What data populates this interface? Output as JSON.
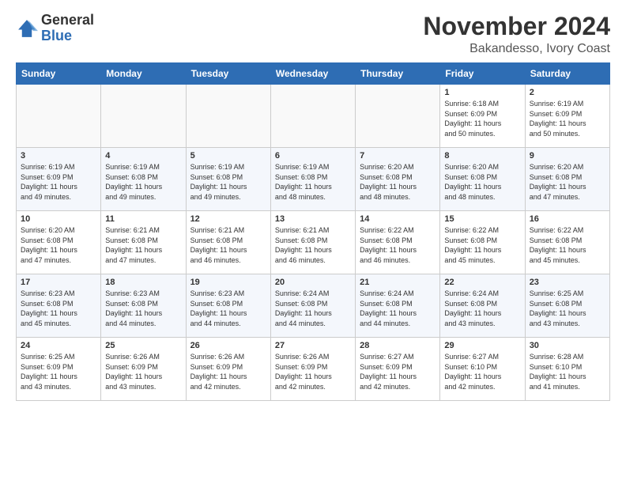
{
  "header": {
    "logo": {
      "general": "General",
      "blue": "Blue"
    },
    "title": "November 2024",
    "location": "Bakandesso, Ivory Coast"
  },
  "calendar": {
    "days_of_week": [
      "Sunday",
      "Monday",
      "Tuesday",
      "Wednesday",
      "Thursday",
      "Friday",
      "Saturday"
    ],
    "weeks": [
      [
        {
          "day": "",
          "info": ""
        },
        {
          "day": "",
          "info": ""
        },
        {
          "day": "",
          "info": ""
        },
        {
          "day": "",
          "info": ""
        },
        {
          "day": "",
          "info": ""
        },
        {
          "day": "1",
          "info": "Sunrise: 6:18 AM\nSunset: 6:09 PM\nDaylight: 11 hours\nand 50 minutes."
        },
        {
          "day": "2",
          "info": "Sunrise: 6:19 AM\nSunset: 6:09 PM\nDaylight: 11 hours\nand 50 minutes."
        }
      ],
      [
        {
          "day": "3",
          "info": "Sunrise: 6:19 AM\nSunset: 6:09 PM\nDaylight: 11 hours\nand 49 minutes."
        },
        {
          "day": "4",
          "info": "Sunrise: 6:19 AM\nSunset: 6:08 PM\nDaylight: 11 hours\nand 49 minutes."
        },
        {
          "day": "5",
          "info": "Sunrise: 6:19 AM\nSunset: 6:08 PM\nDaylight: 11 hours\nand 49 minutes."
        },
        {
          "day": "6",
          "info": "Sunrise: 6:19 AM\nSunset: 6:08 PM\nDaylight: 11 hours\nand 48 minutes."
        },
        {
          "day": "7",
          "info": "Sunrise: 6:20 AM\nSunset: 6:08 PM\nDaylight: 11 hours\nand 48 minutes."
        },
        {
          "day": "8",
          "info": "Sunrise: 6:20 AM\nSunset: 6:08 PM\nDaylight: 11 hours\nand 48 minutes."
        },
        {
          "day": "9",
          "info": "Sunrise: 6:20 AM\nSunset: 6:08 PM\nDaylight: 11 hours\nand 47 minutes."
        }
      ],
      [
        {
          "day": "10",
          "info": "Sunrise: 6:20 AM\nSunset: 6:08 PM\nDaylight: 11 hours\nand 47 minutes."
        },
        {
          "day": "11",
          "info": "Sunrise: 6:21 AM\nSunset: 6:08 PM\nDaylight: 11 hours\nand 47 minutes."
        },
        {
          "day": "12",
          "info": "Sunrise: 6:21 AM\nSunset: 6:08 PM\nDaylight: 11 hours\nand 46 minutes."
        },
        {
          "day": "13",
          "info": "Sunrise: 6:21 AM\nSunset: 6:08 PM\nDaylight: 11 hours\nand 46 minutes."
        },
        {
          "day": "14",
          "info": "Sunrise: 6:22 AM\nSunset: 6:08 PM\nDaylight: 11 hours\nand 46 minutes."
        },
        {
          "day": "15",
          "info": "Sunrise: 6:22 AM\nSunset: 6:08 PM\nDaylight: 11 hours\nand 45 minutes."
        },
        {
          "day": "16",
          "info": "Sunrise: 6:22 AM\nSunset: 6:08 PM\nDaylight: 11 hours\nand 45 minutes."
        }
      ],
      [
        {
          "day": "17",
          "info": "Sunrise: 6:23 AM\nSunset: 6:08 PM\nDaylight: 11 hours\nand 45 minutes."
        },
        {
          "day": "18",
          "info": "Sunrise: 6:23 AM\nSunset: 6:08 PM\nDaylight: 11 hours\nand 44 minutes."
        },
        {
          "day": "19",
          "info": "Sunrise: 6:23 AM\nSunset: 6:08 PM\nDaylight: 11 hours\nand 44 minutes."
        },
        {
          "day": "20",
          "info": "Sunrise: 6:24 AM\nSunset: 6:08 PM\nDaylight: 11 hours\nand 44 minutes."
        },
        {
          "day": "21",
          "info": "Sunrise: 6:24 AM\nSunset: 6:08 PM\nDaylight: 11 hours\nand 44 minutes."
        },
        {
          "day": "22",
          "info": "Sunrise: 6:24 AM\nSunset: 6:08 PM\nDaylight: 11 hours\nand 43 minutes."
        },
        {
          "day": "23",
          "info": "Sunrise: 6:25 AM\nSunset: 6:08 PM\nDaylight: 11 hours\nand 43 minutes."
        }
      ],
      [
        {
          "day": "24",
          "info": "Sunrise: 6:25 AM\nSunset: 6:09 PM\nDaylight: 11 hours\nand 43 minutes."
        },
        {
          "day": "25",
          "info": "Sunrise: 6:26 AM\nSunset: 6:09 PM\nDaylight: 11 hours\nand 43 minutes."
        },
        {
          "day": "26",
          "info": "Sunrise: 6:26 AM\nSunset: 6:09 PM\nDaylight: 11 hours\nand 42 minutes."
        },
        {
          "day": "27",
          "info": "Sunrise: 6:26 AM\nSunset: 6:09 PM\nDaylight: 11 hours\nand 42 minutes."
        },
        {
          "day": "28",
          "info": "Sunrise: 6:27 AM\nSunset: 6:09 PM\nDaylight: 11 hours\nand 42 minutes."
        },
        {
          "day": "29",
          "info": "Sunrise: 6:27 AM\nSunset: 6:10 PM\nDaylight: 11 hours\nand 42 minutes."
        },
        {
          "day": "30",
          "info": "Sunrise: 6:28 AM\nSunset: 6:10 PM\nDaylight: 11 hours\nand 41 minutes."
        }
      ]
    ]
  }
}
